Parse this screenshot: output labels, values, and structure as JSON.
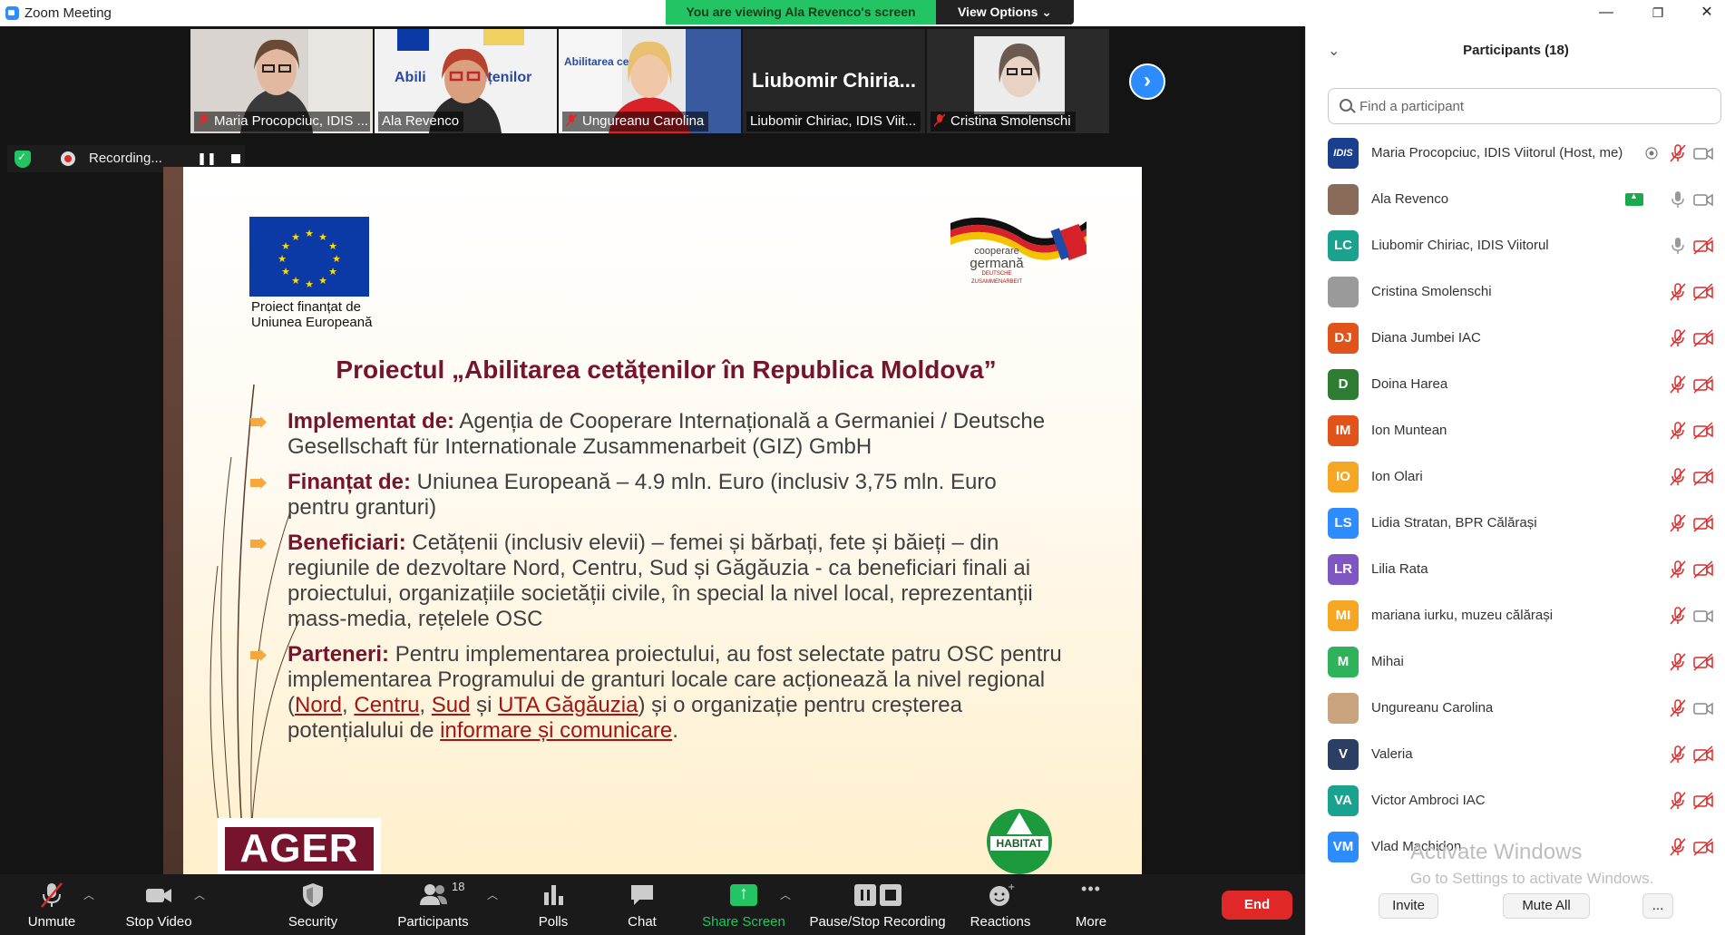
{
  "window": {
    "title": "Zoom Meeting",
    "minimize": "—",
    "maximize": "❐",
    "close": "✕"
  },
  "share_banner": {
    "text": "You are viewing Ala Revenco's screen",
    "view_options": "View Options ⌄"
  },
  "thumbnails": [
    {
      "name": "Maria Procopciuc, IDIS ...",
      "muted": true
    },
    {
      "name": "Ala Revenco",
      "muted": false,
      "active": true
    },
    {
      "name": "Ungureanu Carolina",
      "muted": true
    },
    {
      "name": "Liubomir Chiriac, IDIS Viit...",
      "big_name": "Liubomir  Chiria...",
      "muted": false
    },
    {
      "name": "Cristina Smolenschi",
      "muted": true
    }
  ],
  "recording": {
    "label": "Recording..."
  },
  "slide": {
    "eu_caption_line1": "Proiect finanțat de",
    "eu_caption_line2": "Uniunea Europeană",
    "coop_line1": "cooperare",
    "coop_line2": "germană",
    "coop_line3": "DEUTSCHE ZUSAMMENARBEIT",
    "title": "Proiectul „Abilitarea cetățenilor în Republica Moldova”",
    "bullets": {
      "implementat_key": "Implementat de:",
      "implementat_text": " Agenția de Cooperare Internațională a Germaniei / Deutsche Gesellschaft für Internationale Zusammenarbeit (GIZ) GmbH",
      "finantat_key": "Finanțat de:",
      "finantat_text": " Uniunea Europeană – 4.9 mln. Euro (inclusiv 3,75 mln. Euro pentru granturi)",
      "beneficiari_key": "Beneficiari:",
      "beneficiari_text": " Cetățenii (inclusiv elevii) – femei și bărbați, fete și băieți – din regiunile de dezvoltare Nord, Centru, Sud și Găgăuzia - ca beneficiari finali ai proiectului, organizațiile societății civile, în special la nivel local, reprezentanții mass-media, rețelele OSC",
      "parteneri_key": "Parteneri:",
      "parteneri_text1": " Pentru implementarea proiectului, au fost selectate patru OSC pentru implementarea Programului de granturi locale care acționează la nivel regional (",
      "link_nord": "Nord",
      "sep1": ", ",
      "link_centru": "Centru",
      "sep2": ", ",
      "link_sud": "Sud",
      "sep3": " și ",
      "link_uta": "UTA Găgăuzia",
      "parteneri_text2": ") și o organizație pentru creșterea potențialului de ",
      "link_informare": "informare și comunicare",
      "end": "."
    },
    "ager": "AGER",
    "habitat": "HABITAT"
  },
  "panel": {
    "title": "Participants (18)",
    "search_placeholder": "Find a participant",
    "participants": [
      {
        "initials": "IDIS",
        "name": "Maria Procopciuc, IDIS Viitorul (Host, me)",
        "color": "#1b3f8f",
        "mic": "red",
        "cam": "gray",
        "extra": "record"
      },
      {
        "initials": "",
        "name": "Ala Revenco",
        "color": "#8a6a5a",
        "mic": "gray",
        "cam": "gray",
        "extra": "share"
      },
      {
        "initials": "LC",
        "name": "Liubomir Chiriac, IDIS Viitorul",
        "color": "#19a38f",
        "mic": "gray",
        "cam": "red"
      },
      {
        "initials": "",
        "name": "Cristina Smolenschi",
        "color": "#9a9a9a",
        "mic": "red",
        "cam": "red"
      },
      {
        "initials": "DJ",
        "name": "Diana Jumbei IAC",
        "color": "#e0541b",
        "mic": "red",
        "cam": "red"
      },
      {
        "initials": "D",
        "name": "Doina Harea",
        "color": "#2e7d32",
        "mic": "red",
        "cam": "red"
      },
      {
        "initials": "IM",
        "name": "Ion Muntean",
        "color": "#e0541b",
        "mic": "red",
        "cam": "red"
      },
      {
        "initials": "IO",
        "name": "Ion Olari",
        "color": "#f5a623",
        "mic": "red",
        "cam": "red"
      },
      {
        "initials": "LS",
        "name": "Lidia Stratan, BPR Călărași",
        "color": "#2d8cff",
        "mic": "red",
        "cam": "red"
      },
      {
        "initials": "LR",
        "name": "Lilia Rata",
        "color": "#7e57c2",
        "mic": "red",
        "cam": "red"
      },
      {
        "initials": "MI",
        "name": "mariana iurku, muzeu călărași",
        "color": "#f5a623",
        "mic": "red",
        "cam": "gray"
      },
      {
        "initials": "M",
        "name": "Mihai",
        "color": "#2fb35a",
        "mic": "red",
        "cam": "red"
      },
      {
        "initials": "",
        "name": "Ungureanu Carolina",
        "color": "#c9a27e",
        "mic": "red",
        "cam": "gray"
      },
      {
        "initials": "V",
        "name": "Valeria",
        "color": "#2a3f63",
        "mic": "red",
        "cam": "red"
      },
      {
        "initials": "VA",
        "name": "Victor Ambroci IAC",
        "color": "#19a38f",
        "mic": "red",
        "cam": "red"
      },
      {
        "initials": "VM",
        "name": "Vlad Machidon",
        "color": "#2d8cff",
        "mic": "red",
        "cam": "red"
      }
    ],
    "watermark_title": "Activate Windows",
    "watermark_sub": "Go to Settings to activate Windows.",
    "invite": "Invite",
    "mute_all": "Mute All",
    "more": "..."
  },
  "toolbar": {
    "unmute": "Unmute",
    "stop_video": "Stop Video",
    "security": "Security",
    "participants": "Participants",
    "participants_count": "18",
    "polls": "Polls",
    "chat": "Chat",
    "share_screen": "Share Screen",
    "pause_stop_recording": "Pause/Stop Recording",
    "reactions": "Reactions",
    "more": "More",
    "end": "End",
    "more_dots": "•••"
  },
  "colors": {
    "accent": "#2d8cff",
    "share_green": "#23c464",
    "end_red": "#e02828",
    "slide_title": "#75142c",
    "bullet_arrow": "#f5a83c"
  }
}
